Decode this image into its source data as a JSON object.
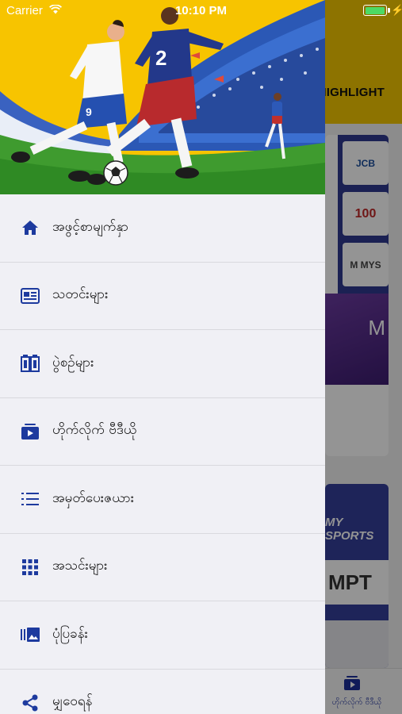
{
  "status_bar": {
    "carrier": "Carrier",
    "time": "10:10 PM"
  },
  "background_app": {
    "header_title": "HIGHLIGHT",
    "sponsors": [
      "JCB",
      "100",
      "M MYS"
    ],
    "card2_label": "MY SPORTS",
    "card2_logo": "MPT",
    "player_letter": "M",
    "active_tab_label": "ဟိုက်လိုက် ဗီဒီယို"
  },
  "drawer": {
    "hero": {
      "player_number_1": "9",
      "player_number_2": "2"
    },
    "menu_items": [
      {
        "label": "အဖွင့်စာမျက်နှာ",
        "icon": "home-icon"
      },
      {
        "label": "သတင်းများ",
        "icon": "newspaper-icon"
      },
      {
        "label": "ပွဲစဉ်များ",
        "icon": "fixtures-icon"
      },
      {
        "label": "ဟိုက်လိုက် ဗီဒီယို",
        "icon": "video-icon"
      },
      {
        "label": "အမှတ်ပေးဇယား",
        "icon": "list-icon"
      },
      {
        "label": "အသင်းများ",
        "icon": "grid-icon"
      },
      {
        "label": "ပုံပြခန်း",
        "icon": "gallery-icon"
      },
      {
        "label": "မျှဝေရန်",
        "icon": "share-icon"
      }
    ]
  },
  "colors": {
    "brand_yellow": "#f3c600",
    "icon_blue": "#1d3a9e",
    "drawer_bg": "#f0f0f5"
  }
}
